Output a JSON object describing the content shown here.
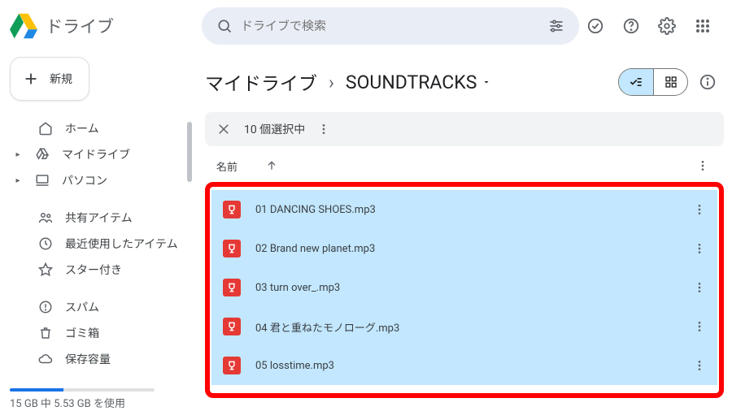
{
  "brand": {
    "title": "ドライブ"
  },
  "search": {
    "placeholder": "ドライブで検索"
  },
  "newButton": {
    "label": "新規"
  },
  "sidebar": {
    "items": [
      {
        "label": "ホーム"
      },
      {
        "label": "マイドライブ"
      },
      {
        "label": "パソコン"
      },
      {
        "label": "共有アイテム"
      },
      {
        "label": "最近使用したアイテム"
      },
      {
        "label": "スター付き"
      },
      {
        "label": "スパム"
      },
      {
        "label": "ゴミ箱"
      },
      {
        "label": "保存容量"
      }
    ]
  },
  "storage": {
    "text": "15 GB 中 5.53 GB を使用",
    "percent": 36.9
  },
  "breadcrumb": {
    "root": "マイドライブ",
    "folder": "SOUNDTRACKS"
  },
  "selection": {
    "text": "10 個選択中"
  },
  "columns": {
    "name": "名前"
  },
  "files": [
    {
      "name": "01 DANCING SHOES.mp3"
    },
    {
      "name": "02 Brand new planet.mp3"
    },
    {
      "name": "03 turn over_.mp3"
    },
    {
      "name": "04 君と重ねたモノローグ.mp3"
    },
    {
      "name": "05 losstime.mp3"
    }
  ]
}
